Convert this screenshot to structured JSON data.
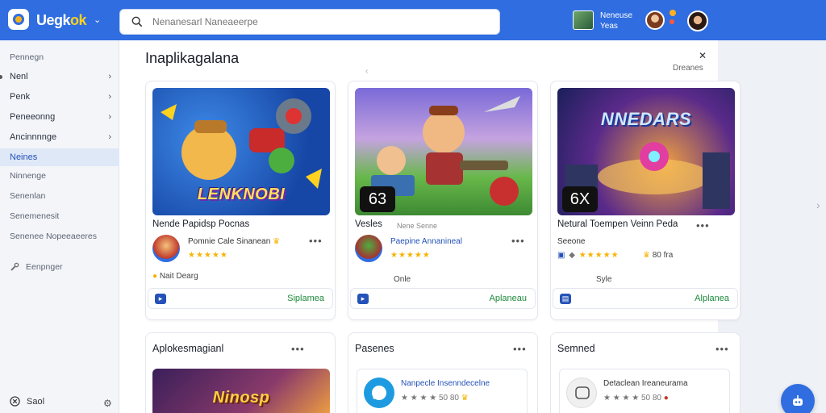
{
  "header": {
    "brand_prefix": "Uegk",
    "brand_accent": "ok",
    "search_placeholder": "Nenanesarl Naneaeerpe",
    "user_line1": "Neneuse",
    "user_line2": "Yeas"
  },
  "sidebar": {
    "heading": "Pennegn",
    "items": [
      {
        "label": "Nenl",
        "chevron": true
      },
      {
        "label": "Penk",
        "chevron": true
      },
      {
        "label": "Peneeonng",
        "chevron": true
      },
      {
        "label": "Ancinnnnge",
        "chevron": true
      },
      {
        "label": "Neines",
        "chevron": false,
        "active": true
      },
      {
        "label": "Ninnenge",
        "chevron": false
      },
      {
        "label": "Senenlan",
        "chevron": false
      },
      {
        "label": "Senemenesit",
        "chevron": false
      },
      {
        "label": "Senenee Nopeeaeeres",
        "chevron": false
      }
    ],
    "settings_label": "Eenpnger",
    "footer_label": "Saol"
  },
  "main": {
    "title": "Inaplikagalana",
    "view_all": "Dreanes",
    "cards": [
      {
        "image_title": "LENKNOBI",
        "name": "Nende Papidsp Pocnas",
        "developer": "Pomnie Cale Sinanean",
        "rating": 5,
        "meta": "Nait Dearg",
        "action": "Siplamea"
      },
      {
        "score": "63",
        "name": "Vesles",
        "name_meta": "Nene Senne",
        "developer": "Paepine Annanineal",
        "rating": 5,
        "meta": "Onle",
        "action": "Aplaneau"
      },
      {
        "image_title": "NNEDARS",
        "score": "6X",
        "name": "Netural Toempen Veinn Peda",
        "developer": "Seeone",
        "rating": 5,
        "meta": "Syle",
        "rating_text": "80 fra",
        "action": "Alplanea"
      }
    ],
    "lower_cards": [
      {
        "title": "Aplokesmagianl",
        "image_title": "Ninosp"
      },
      {
        "title": "Pasenes",
        "inner_title": "Nanpecle Insenndecelne",
        "inner_meta": "★ ★ ★ ★ 50 80"
      },
      {
        "title": "Semned",
        "inner_title": "Detaclean Ireaneurama",
        "inner_meta": "★ ★ ★ ★ 50 80"
      }
    ]
  },
  "colors": {
    "topbar": "#2f6de0",
    "accent_green": "#1e8a3c",
    "link_blue": "#2452b8",
    "star": "#f5b400"
  }
}
